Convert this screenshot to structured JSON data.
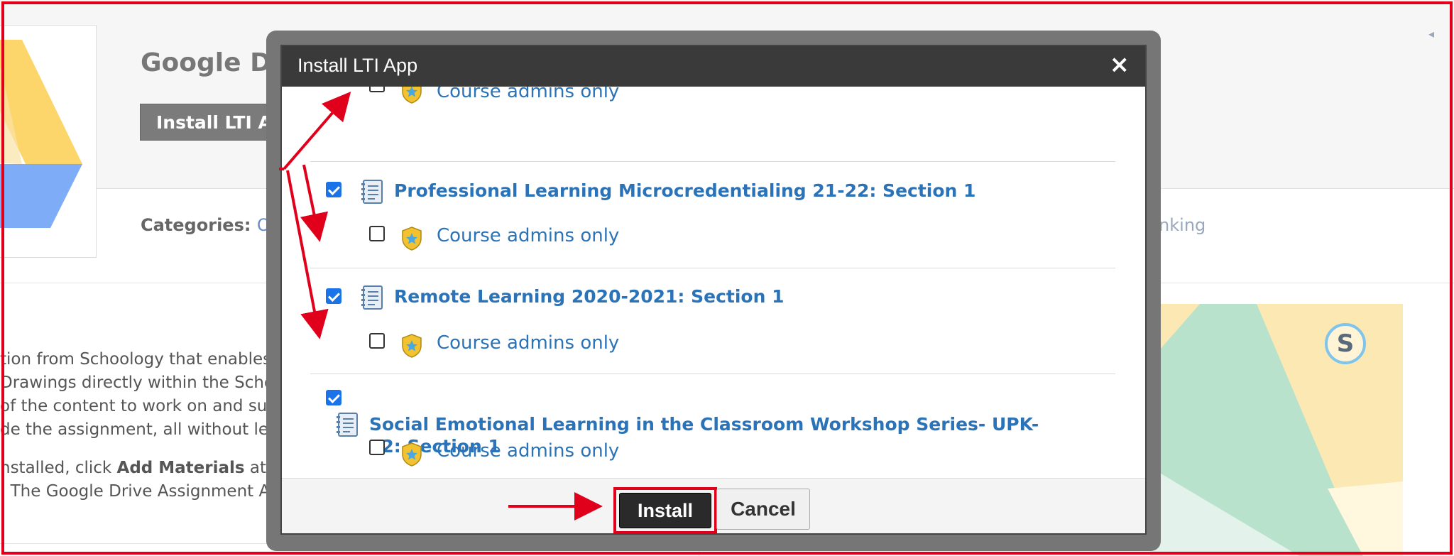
{
  "background": {
    "app_title": "Google Drive Assignments App",
    "install_button_label": "Install LTI App",
    "categories_label": "Categories:",
    "categories_value": "Other",
    "linking_text": "Linking",
    "description": [
      "tion from Schoology that enables in",
      "Drawings directly within the Schoolo",
      "of the content to work on and subr",
      "de the assignment, all without leav"
    ],
    "instructions_prefix": "nstalled, click ",
    "instructions_bold": "Add Materials",
    "instructions_suffix": " at the",
    "instructions_line2": ". The Google Drive Assignment App",
    "hero_badge": "S"
  },
  "modal": {
    "title": "Install LTI App",
    "close_symbol": "×",
    "partial_row": {
      "admins_label": "Course admins only",
      "checked": false
    },
    "courses": [
      {
        "title": "Professional Learning Microcredentialing 21-22: Section 1",
        "checked": true,
        "admins_label": "Course admins only",
        "admins_checked": false
      },
      {
        "title": "Remote Learning 2020-2021: Section 1",
        "checked": true,
        "admins_label": "Course admins only",
        "admins_checked": false
      },
      {
        "title": "Social Emotional Learning in the Classroom Workshop Series- UPK-12: Section 1",
        "checked": true,
        "admins_label": "Course admins only",
        "admins_checked": false
      }
    ],
    "install_label": "Install",
    "cancel_label": "Cancel"
  },
  "colors": {
    "annotation_red": "#e0001b",
    "link_blue": "#2b73b8",
    "checkbox_blue": "#1a73e8",
    "modal_header": "#3a3a3a"
  }
}
